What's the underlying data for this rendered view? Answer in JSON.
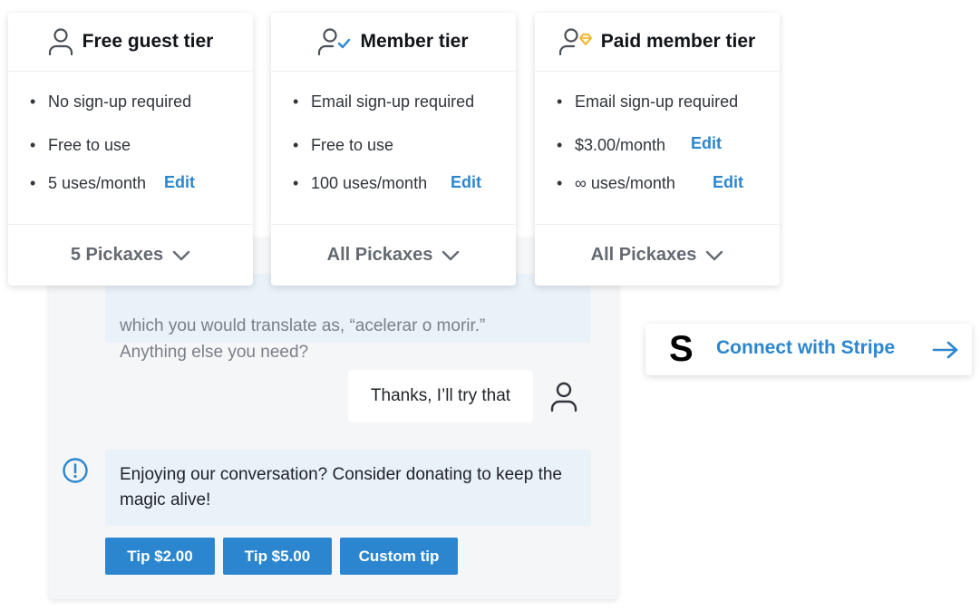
{
  "chat": {
    "ai_message": {
      "line1": "which you would translate as, “acelerar o morir.”",
      "line2": "Anything else you need?"
    },
    "user_message": "Thanks, I’ll try that",
    "donation_prompt": "Enjoying our conversation? Consider donating to keep the magic alive!",
    "tips": [
      {
        "label": "Tip $2.00"
      },
      {
        "label": "Tip $5.00"
      },
      {
        "label": "Custom tip"
      }
    ]
  },
  "tiers": [
    {
      "title": "Free guest tier",
      "icon": "user-icon",
      "items": [
        "No sign-up required",
        "Free to use",
        "5 uses/month"
      ],
      "edit_label": "Edit",
      "footer": "5 Pickaxes"
    },
    {
      "title": "Member tier",
      "icon": "user-check-icon",
      "items": [
        "Email sign-up required",
        "Free to use",
        "100 uses/month"
      ],
      "edit_label": "Edit",
      "footer": "All Pickaxes"
    },
    {
      "title": "Paid member tier",
      "icon": "user-gem-icon",
      "items": [
        "Email sign-up required",
        "$3.00/month",
        "∞ uses/month"
      ],
      "edit_label": "Edit",
      "footer": "All Pickaxes"
    }
  ],
  "stripe": {
    "logo": "S",
    "label": "Connect with Stripe"
  },
  "bullet": "•",
  "colors": {
    "accent": "#2b86cf",
    "bubble": "#e9f1f9",
    "gem": "#f2b124"
  }
}
